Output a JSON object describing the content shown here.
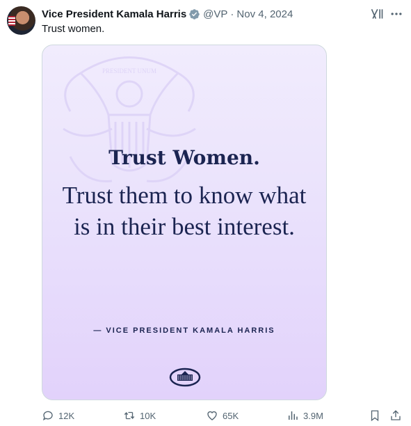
{
  "author": {
    "name": "Vice President Kamala Harris",
    "handle": "@VP",
    "separator": "·",
    "date": "Nov 4, 2024"
  },
  "tweet": {
    "text": "Trust women."
  },
  "media": {
    "seal_text": "PRESIDENT UNUM",
    "headline": "Trust Women.",
    "body": "Trust them to know what is in their best interest.",
    "attribution": "— VICE PRESIDENT KAMALA HARRIS"
  },
  "actions": {
    "replies": "12K",
    "retweets": "10K",
    "likes": "65K",
    "views": "3.9M"
  },
  "icons": {
    "verified": "verified-badge-icon",
    "grok": "grok-icon",
    "more": "more-icon",
    "reply": "reply-icon",
    "retweet": "retweet-icon",
    "like": "heart-icon",
    "views": "views-icon",
    "bookmark": "bookmark-icon",
    "share": "share-icon"
  },
  "colors": {
    "verified": "#829aab",
    "text": "#0f1419",
    "muted": "#536471",
    "quote": "#1b2451"
  }
}
